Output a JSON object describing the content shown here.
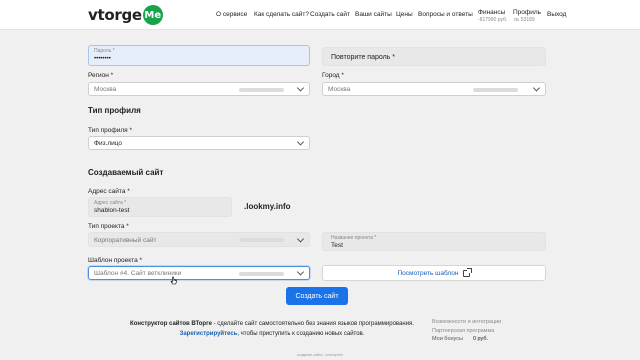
{
  "header": {
    "logo_text": "vtorge",
    "logo_badge": "Me",
    "nav": [
      {
        "label": "О сервисе"
      },
      {
        "label": "Как сделать сайт?"
      },
      {
        "label": "Создать сайт"
      },
      {
        "label": "Ваши сайты"
      },
      {
        "label": "Цены"
      },
      {
        "label": "Вопросы и ответы"
      },
      {
        "label": "Финансы",
        "sub": "-817990 руб."
      },
      {
        "label": "Профиль",
        "sub": "№ 53189"
      },
      {
        "label": "Выход"
      }
    ]
  },
  "form": {
    "password": {
      "float_label": "Пароль *",
      "value": "••••••••"
    },
    "password_repeat": {
      "placeholder": "Повторите пароль *"
    },
    "region": {
      "label": "Регион *",
      "value": "Москва"
    },
    "city": {
      "label": "Город *",
      "value": "Москва"
    },
    "profile_section": {
      "heading": "Тип профиля",
      "label": "Тип профиля *",
      "value": "Физ.лицо"
    },
    "site_section": {
      "heading": "Создаваемый сайт",
      "address_label": "Адрес сайта *",
      "address_float": "Адрес сайта *",
      "address_value": "shablon-test",
      "domain": ".lookmy.info",
      "project_type_label": "Тип проекта *",
      "project_type_value": "Корпоративный сайт",
      "project_name_float": "Название проекта *",
      "project_name_value": "Test",
      "template_label": "Шаблон проекта *",
      "template_value": "Шаблон #4. Сайт ветклиники",
      "preview_button": "Посмотреть шаблон"
    },
    "submit_button": "Создать сайт"
  },
  "promo": {
    "brand": "Конструктор сайтов ВТорге",
    "text1": " - сделайте сайт самостоятельно без знания языков программирования.",
    "link": "Зарегистрируйтесь",
    "text2": ", чтобы приступить к созданию новых сайтов."
  },
  "side_links": {
    "opportunities": "Возможности и интеграции",
    "partner": "Партнерская программа",
    "bonus_label": "Мои бонусы",
    "bonus_value": "0 руб."
  },
  "footer": {
    "text": "создание сайта - lookmy.info"
  },
  "colors": {
    "accent": "#1a73e8",
    "brand_green": "#16a34a"
  }
}
